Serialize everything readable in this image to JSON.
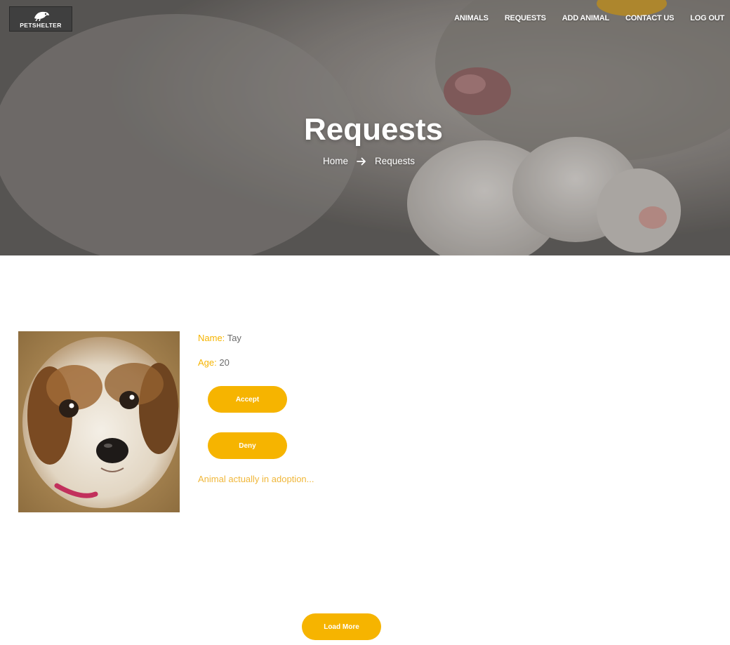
{
  "brand": {
    "logo_text": "PETSHELTER"
  },
  "nav": {
    "items": [
      {
        "label": "ANIMALS"
      },
      {
        "label": "REQUESTS"
      },
      {
        "label": "ADD ANIMAL"
      },
      {
        "label": "CONTACT US"
      },
      {
        "label": "LOG OUT"
      }
    ]
  },
  "hero": {
    "title": "Requests",
    "breadcrumb": {
      "home": "Home",
      "current": "Requests"
    }
  },
  "request": {
    "name_label": "Name:",
    "name_value": "Tay",
    "age_label": "Age:",
    "age_value": "20",
    "accept_label": "Accept",
    "deny_label": "Deny",
    "status_text": "Animal actually in adoption..."
  },
  "load_more_label": "Load More",
  "colors": {
    "accent": "#f6b400",
    "status": "#f0b73a",
    "text": "#6b6b6b"
  }
}
